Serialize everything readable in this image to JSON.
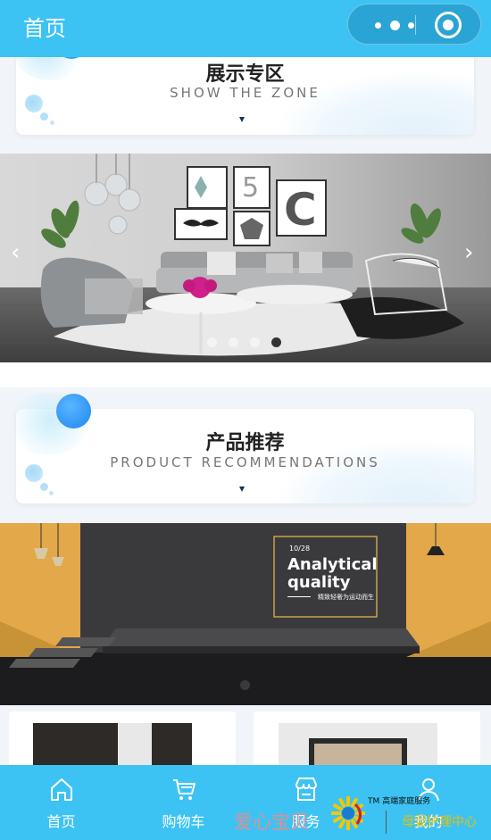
{
  "topbar": {
    "title": "首页",
    "more_icon": "more-dots-icon",
    "close_icon": "target-close-icon"
  },
  "sections": {
    "showcase": {
      "title": "展示专区",
      "subtitle": "SHOW THE ZONE",
      "arrow": "▼"
    },
    "products": {
      "title": "产品推荐",
      "subtitle": "PRODUCT RECOMMENDATIONS",
      "arrow": "▼"
    }
  },
  "banner1": {
    "prev": "‹",
    "next": "›",
    "dots": 4,
    "active_dot": 4
  },
  "banner2": {
    "date": "10/28",
    "headline_1": "Analytical",
    "headline_2": "quality",
    "caption": "精致轻奢为运动而生",
    "dots": 1
  },
  "tabbar": {
    "items": [
      {
        "label": "首页",
        "icon": "home-icon"
      },
      {
        "label": "购物车",
        "icon": "cart-icon"
      },
      {
        "label": "服务",
        "icon": "store-icon"
      },
      {
        "label": "我的",
        "icon": "user-icon"
      }
    ]
  },
  "watermark": {
    "text": "爱心宝贝",
    "tm": "TM 高端家庭服务",
    "sub": "母婴护理中心"
  },
  "colors": {
    "accent": "#3cc3f3",
    "capsule": "#2aa4d4",
    "page_bg": "#f1f5f9"
  }
}
